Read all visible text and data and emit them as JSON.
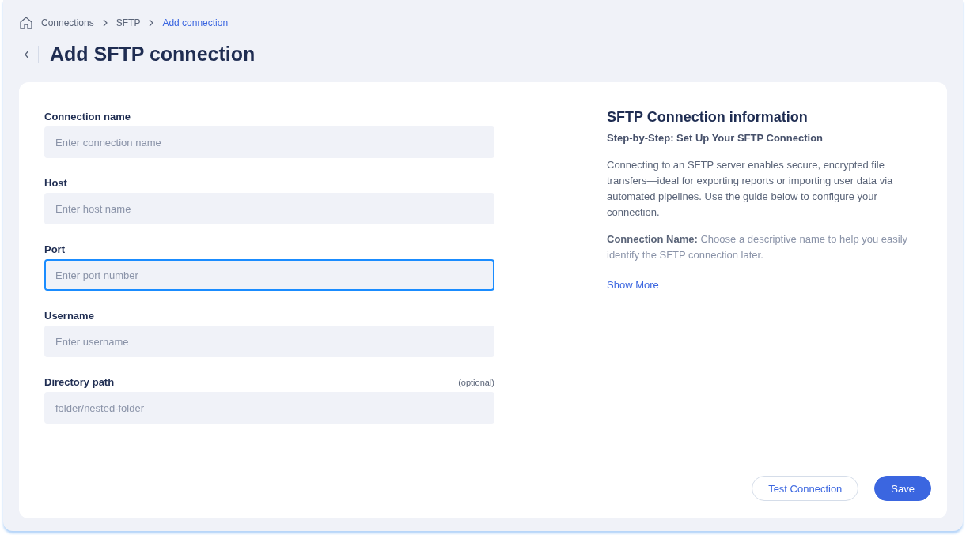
{
  "breadcrumbs": [
    {
      "label": "Connections",
      "selected": false
    },
    {
      "label": "SFTP",
      "selected": false
    },
    {
      "label": "Add connection",
      "selected": true
    }
  ],
  "title": "Add SFTP connection",
  "form": {
    "fields": [
      {
        "label": "Connection name",
        "placeholder": "Enter connection name",
        "focused": false
      },
      {
        "label": "Host",
        "placeholder": "Enter host name",
        "focused": false
      },
      {
        "label": "Port",
        "placeholder": "Enter port number",
        "focused": true
      },
      {
        "label": "Username",
        "placeholder": "Enter username",
        "focused": false
      },
      {
        "label": "Directory path",
        "hint": "(optional)",
        "placeholder": "folder/nested-folder",
        "focused": false
      }
    ]
  },
  "info": {
    "title": "SFTP Connection information",
    "subtitle": "Step-by-Step: Set Up Your SFTP Connection",
    "paragraphs": [
      "Connecting to an SFTP server enables secure, encrypted file transfers—ideal for exporting reports or importing user data via automated pipelines. Use the guide below to configure your connection.",
      "**Connection Name:** Choose a descriptive name to help you easily identify the SFTP connection later."
    ],
    "show_more": "Show More"
  },
  "buttons": [
    {
      "label": "Test Connection",
      "kind": "secondary"
    },
    {
      "label": "Save",
      "kind": "primary"
    }
  ]
}
